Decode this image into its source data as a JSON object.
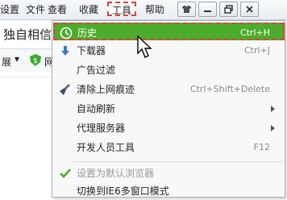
{
  "menubar": {
    "items": [
      "设置",
      "文件",
      "查看",
      "收藏",
      "工具",
      "帮助"
    ]
  },
  "left": {
    "tab_title": "独自相信",
    "strip_label": "展",
    "strip_text": "网"
  },
  "tools_menu": {
    "items": [
      {
        "label": "历史",
        "shortcut": "Ctrl+H",
        "icon": "clock-icon"
      },
      {
        "label": "下载器",
        "shortcut": "Ctrl+J",
        "icon": "download-arrow-icon"
      },
      {
        "label": "广告过滤",
        "shortcut": "",
        "icon": ""
      },
      {
        "label": "清除上网痕迹",
        "shortcut": "Ctrl+Shift+Delete",
        "icon": "broom-icon"
      },
      {
        "label": "自动刷新",
        "shortcut": "",
        "icon": ""
      },
      {
        "label": "代理服务器",
        "shortcut": "",
        "icon": ""
      },
      {
        "label": "开发人员工具",
        "shortcut": "F12",
        "icon": ""
      },
      {
        "label": "设置为默认浏览器",
        "shortcut": "",
        "icon": "checkmark-icon"
      },
      {
        "label": "切换到IE6多窗口模式",
        "shortcut": "",
        "icon": ""
      }
    ]
  },
  "colors": {
    "highlight": "#4cac2c",
    "focus_outline": "#e04040",
    "check_green": "#4cac2c"
  }
}
